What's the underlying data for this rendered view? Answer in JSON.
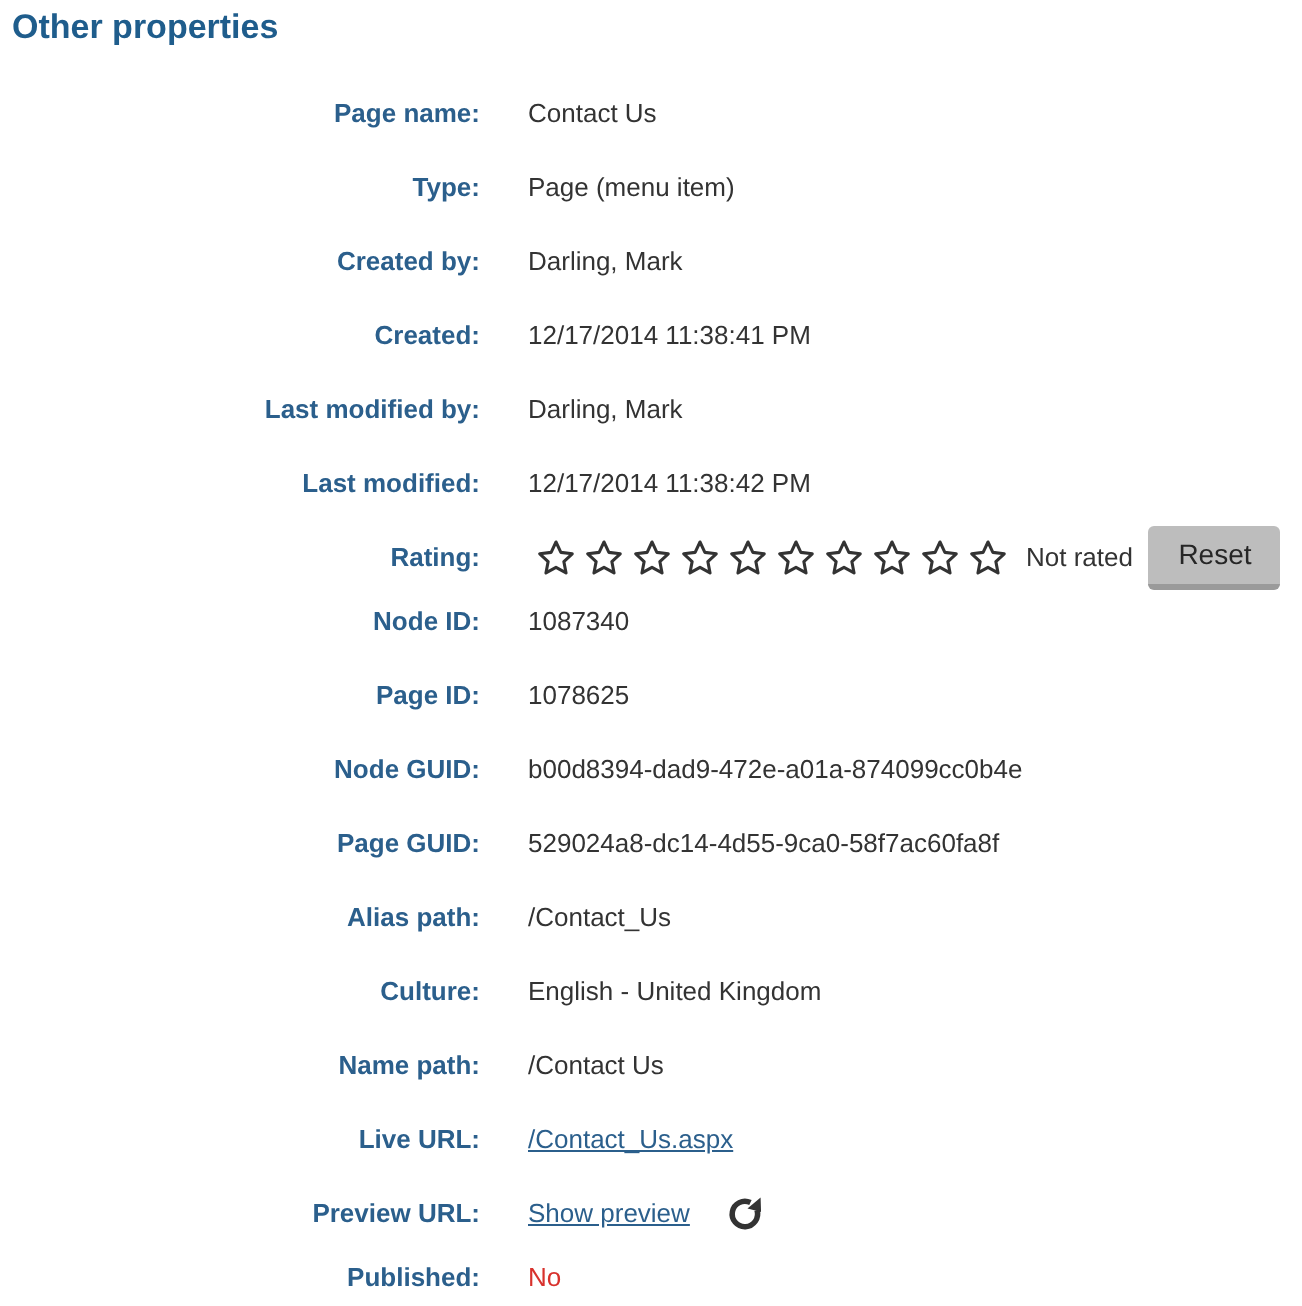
{
  "title": "Other properties",
  "properties": [
    {
      "kind": "text",
      "label": "Page name:",
      "value": "Contact Us"
    },
    {
      "kind": "text",
      "label": "Type:",
      "value": "Page (menu item)"
    },
    {
      "kind": "text",
      "label": "Created by:",
      "value": "Darling, Mark"
    },
    {
      "kind": "text",
      "label": "Created:",
      "value": "12/17/2014 11:38:41 PM"
    },
    {
      "kind": "text",
      "label": "Last modified by:",
      "value": "Darling, Mark"
    },
    {
      "kind": "text",
      "label": "Last modified:",
      "value": "12/17/2014 11:38:42 PM"
    },
    {
      "kind": "rating",
      "label": "Rating:",
      "stars": 0,
      "status": "Not rated",
      "button": "Reset"
    },
    {
      "kind": "text",
      "label": "Node ID:",
      "value": "1087340"
    },
    {
      "kind": "text",
      "label": "Page ID:",
      "value": "1078625"
    },
    {
      "kind": "text",
      "label": "Node GUID:",
      "value": "b00d8394-dad9-472e-a01a-874099cc0b4e"
    },
    {
      "kind": "text",
      "label": "Page GUID:",
      "value": "529024a8-dc14-4d55-9ca0-58f7ac60fa8f"
    },
    {
      "kind": "text",
      "label": "Alias path:",
      "value": "/Contact_Us"
    },
    {
      "kind": "text",
      "label": "Culture:",
      "value": "English - United Kingdom"
    },
    {
      "kind": "text",
      "label": "Name path:",
      "value": "/Contact Us"
    },
    {
      "kind": "link",
      "label": "Live URL:",
      "value": "/Contact_Us.aspx"
    },
    {
      "kind": "preview",
      "label": "Preview URL:",
      "value": "Show preview"
    },
    {
      "kind": "alert",
      "label": "Published:",
      "value": "No"
    }
  ]
}
